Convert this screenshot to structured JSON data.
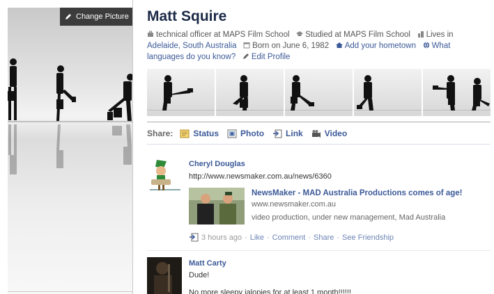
{
  "profile": {
    "change_picture_label": "Change Picture",
    "name": "Matt Squire",
    "info": {
      "job": "technical officer at MAPS Film School",
      "studied": "Studied at MAPS Film School",
      "lives_prefix": "Lives in",
      "lives_city": "Adelaide, South Australia",
      "born": "Born on June 6, 1982",
      "hometown_link": "Add your hometown",
      "languages_link": "What languages do you know?",
      "edit_profile": "Edit Profile"
    }
  },
  "photo_strip": {
    "count": 5
  },
  "share": {
    "label": "Share:",
    "items": [
      {
        "label": "Status",
        "icon": "status-icon"
      },
      {
        "label": "Photo",
        "icon": "photo-icon"
      },
      {
        "label": "Link",
        "icon": "link-icon"
      },
      {
        "label": "Video",
        "icon": "video-icon"
      }
    ]
  },
  "feed": [
    {
      "author": "Cheryl Douglas",
      "url": "http://www.newsmaker.com.au/news/6360",
      "link_title": "NewsMaker - MAD Australia Productions comes of age!",
      "link_domain": "www.newsmaker.com.au",
      "link_description": "video production, under new management, Mad Australia",
      "time": "3 hours ago",
      "actions": [
        "Like",
        "Comment",
        "Share",
        "See Friendship"
      ]
    },
    {
      "author": "Matt Carty",
      "text1": "Dude!",
      "text2": "No more sleepy jalopies for at least 1 month!!!!!!"
    }
  ],
  "colors": {
    "link": "#3b5998",
    "name": "#1c2a47",
    "meta": "#999999"
  }
}
